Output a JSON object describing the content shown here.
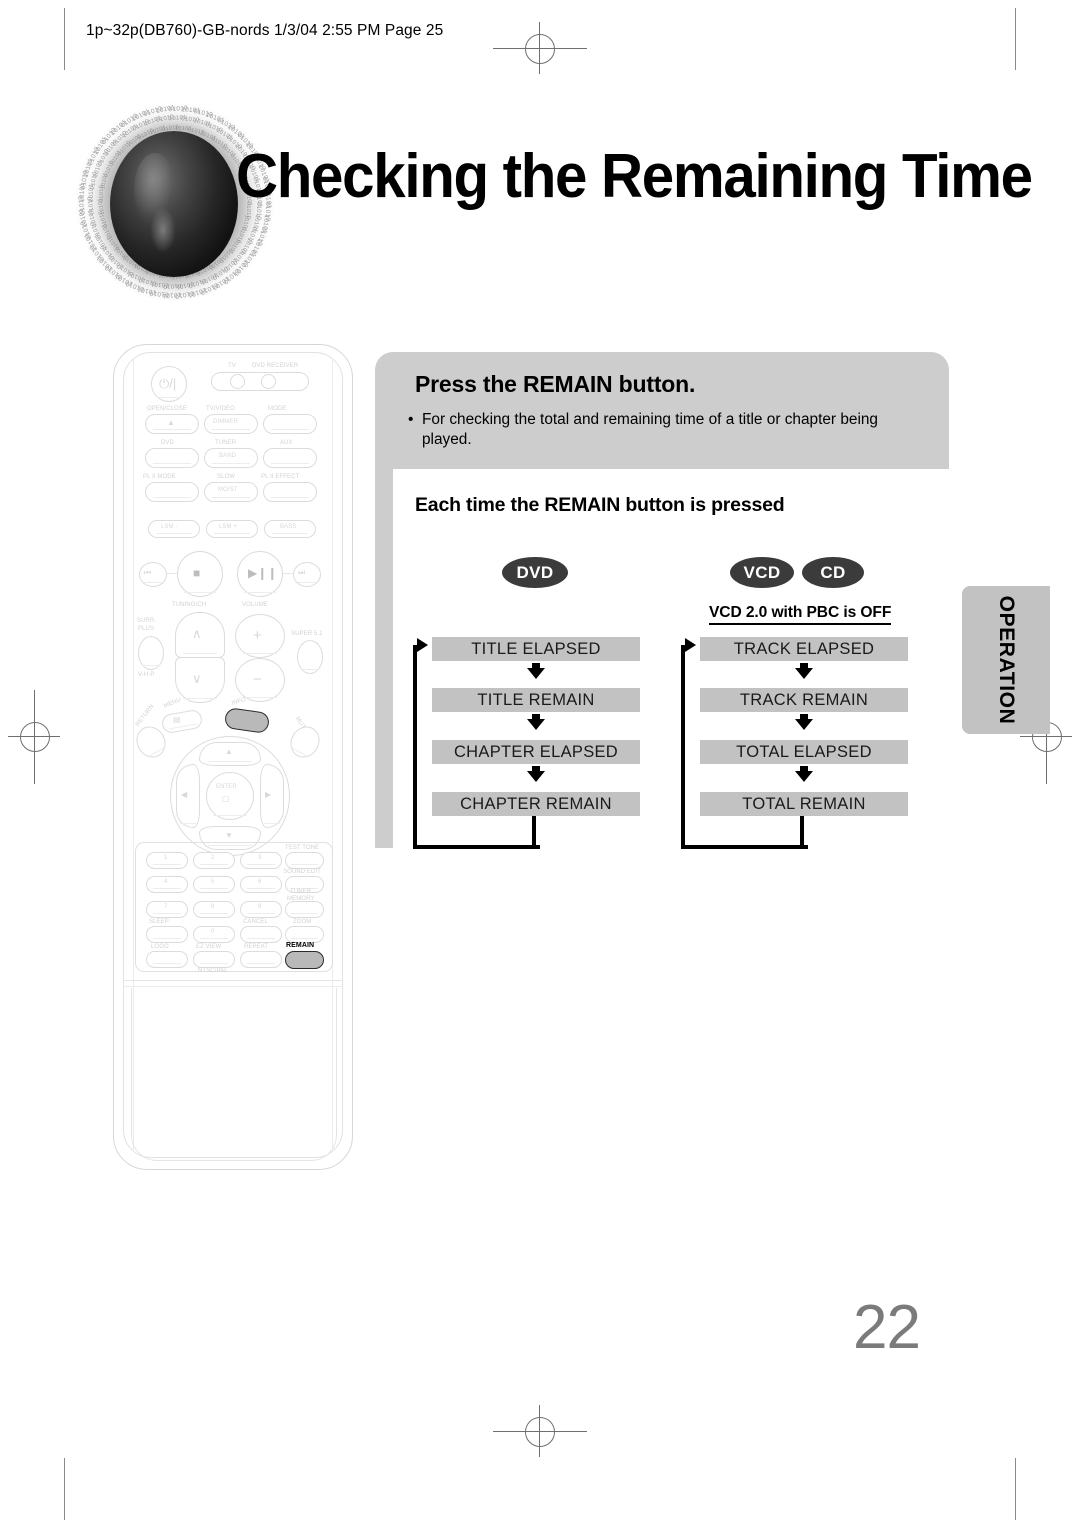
{
  "file_header": "1p~32p(DB760)-GB-nords  1/3/04 2:55 PM  Page 25",
  "page_title": "Checking the Remaining Time",
  "page_number": "22",
  "side_tab": {
    "label": "OPERATION"
  },
  "panel": {
    "heading": "Press the REMAIN button.",
    "bullet_mark": "•",
    "bullet_text": "For checking the total and remaining time of a title or chapter being played."
  },
  "subheading": "Each time the REMAIN button is pressed",
  "badges": {
    "dvd": "DVD",
    "vcd": "VCD",
    "cd": "CD"
  },
  "pbc_note": "VCD 2.0 with PBC is OFF",
  "chart_data": {
    "type": "diagram",
    "title": "Each time the REMAIN button is pressed",
    "columns": [
      {
        "media": [
          "DVD"
        ],
        "note": "",
        "cycle": true,
        "steps": [
          "TITLE ELAPSED",
          "TITLE REMAIN",
          "CHAPTER ELAPSED",
          "CHAPTER REMAIN"
        ]
      },
      {
        "media": [
          "VCD",
          "CD"
        ],
        "note": "VCD 2.0 with PBC is OFF",
        "cycle": true,
        "steps": [
          "TRACK ELAPSED",
          "TRACK REMAIN",
          "TOTAL ELAPSED",
          "TOTAL REMAIN"
        ]
      }
    ]
  },
  "remote": {
    "power": "⏻/|",
    "tv_label": "TV",
    "dvd_receiver_label": "DVD RECEIVER",
    "row_open": {
      "open_close": "OPEN/CLOSE",
      "tv_video": "TV/VIDEO",
      "dimmer": "DIMMER",
      "mode": "MODE"
    },
    "row_dvd": {
      "dvd": "DVD",
      "tuner": "TUNER",
      "band": "BAND",
      "aux": "AUX"
    },
    "row_pl2": {
      "pl2_mode": "PL II MODE",
      "slow": "SLOW",
      "most": "MO/ST",
      "pl2_effect": "PL II EFFECT"
    },
    "row_lsm": {
      "lsm_minus": "LSM -",
      "lsm_plus": "LSM +",
      "bass": "BASS"
    },
    "transport": {
      "prev": "⏮",
      "stop": "■",
      "play_pause": "▶❙❙",
      "next": "⏭"
    },
    "tuning_label": "TUNING/CH",
    "volume_label": "VOLUME",
    "surr_plus": "SURR.\nPLUS",
    "vhp": "V-H·P",
    "super51": "SUPER 5.1",
    "menu": "MENU",
    "info": "INFO",
    "return": "RETURN",
    "mute": "MUTE",
    "enter": "ENTER",
    "keypad": [
      "1",
      "2",
      "3",
      "4",
      "5",
      "6",
      "7",
      "8",
      "9",
      "0"
    ],
    "test_tone": "TEST TONE",
    "sound_edit": "SOUND EDIT",
    "tuner_memory": "TUNER\nMEMORY",
    "sleep": "SLEEP",
    "cancel": "CANCEL",
    "zoom": "ZOOM",
    "logo": "LOGO",
    "ez_view": "EZ VIEW",
    "repeat": "REPEAT",
    "remain": "REMAIN",
    "ntsc_pal": "NTSC/PAL"
  }
}
